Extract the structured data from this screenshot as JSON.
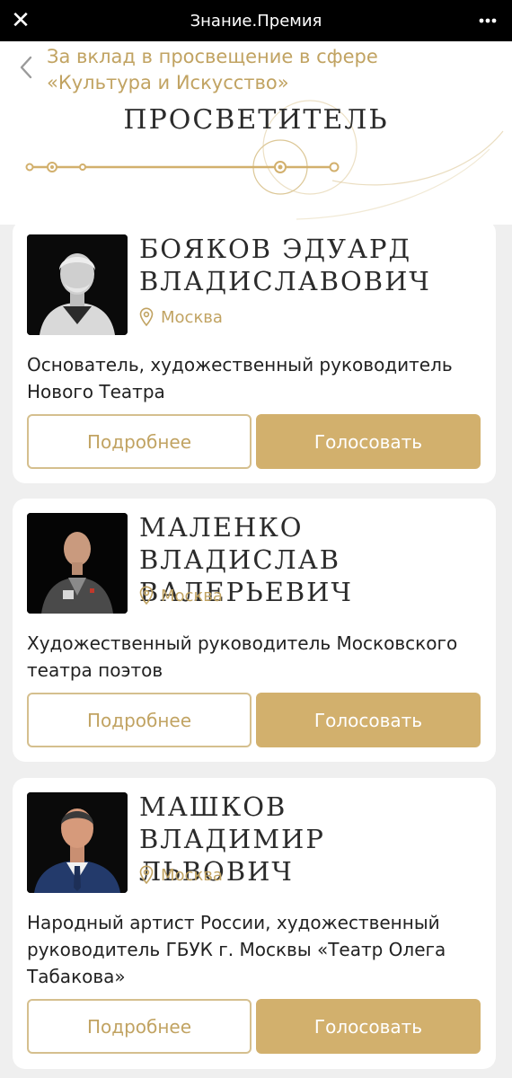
{
  "topbar": {
    "title": "Знание.Премия",
    "close_icon": "close-icon",
    "menu_icon": "more-vertical-icon"
  },
  "header": {
    "category": "За вклад в просвещение в сфере «Культура и Искусство»",
    "section_title": "ПРОСВЕТИТЕЛЬ",
    "back_icon": "chevron-left-icon"
  },
  "colors": {
    "accent": "#c1a362",
    "button_fill": "#d2b06d",
    "button_border": "#d5bf8e",
    "background": "#efefef"
  },
  "nominees": [
    {
      "name": "БОЯКОВ ЭДУАРД ВЛАДИСЛАВОВИЧ",
      "city": "Москва",
      "description": "Основатель, художественный руководитель Нового Театра",
      "more_label": "Подробнее",
      "vote_label": "Голосовать"
    },
    {
      "name": "МАЛЕНКО ВЛАДИСЛАВ ВАЛЕРЬЕВИЧ",
      "city": "Москва",
      "description": "Художественный руководитель Московского театра поэтов",
      "more_label": "Подробнее",
      "vote_label": "Голосовать"
    },
    {
      "name": "МАШКОВ ВЛАДИМИР ЛЬВОВИЧ",
      "city": "Москва",
      "description": "Народный артист России, художественный руководитель ГБУК г. Москвы «Театр Олега Табакова»",
      "more_label": "Подробнее",
      "vote_label": "Голосовать"
    }
  ]
}
